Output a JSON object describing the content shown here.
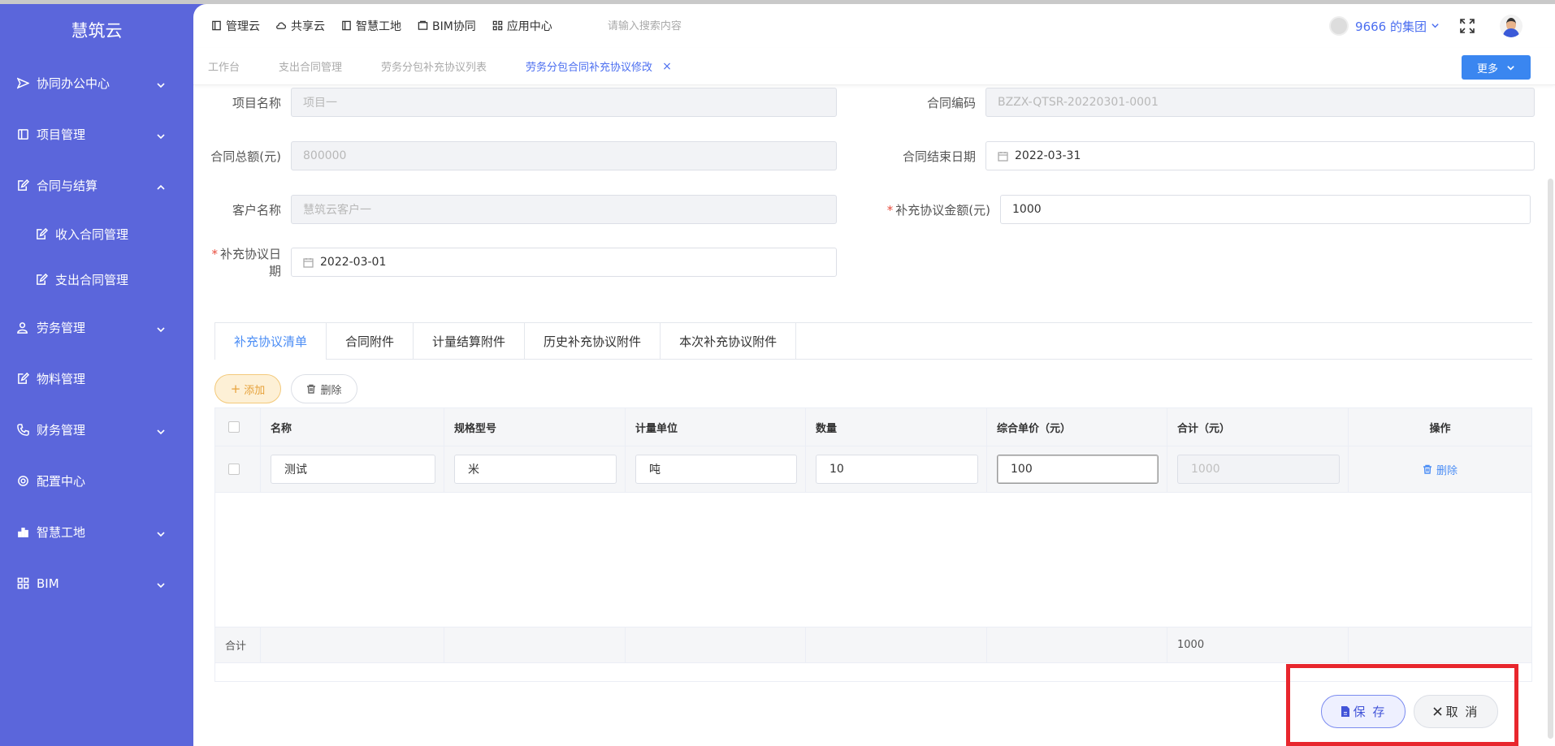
{
  "sidebar": {
    "brand": "慧筑云",
    "items": [
      {
        "label": "协同办公中心"
      },
      {
        "label": "项目管理"
      },
      {
        "label": "合同与结算"
      },
      {
        "label": "收入合同管理"
      },
      {
        "label": "支出合同管理"
      },
      {
        "label": "劳务管理"
      },
      {
        "label": "物料管理"
      },
      {
        "label": "财务管理"
      },
      {
        "label": "配置中心"
      },
      {
        "label": "智慧工地"
      },
      {
        "label": "BIM"
      }
    ]
  },
  "header": {
    "nav": [
      "管理云",
      "共享云",
      "智慧工地",
      "BIM协同",
      "应用中心"
    ],
    "search_placeholder": "请输入搜索内容",
    "org_name": "9666 的集团"
  },
  "tabs": {
    "items": [
      "工作台",
      "支出合同管理",
      "劳务分包补充协议列表",
      "劳务分包合同补充协议修改"
    ],
    "close": "×",
    "more": "更多"
  },
  "form": {
    "project_name_label": "项目名称",
    "project_name_value": "项目一",
    "contract_code_label": "合同编码",
    "contract_code_value": "BZZX-QTSR-20220301-0001",
    "total_amount_label": "合同总额(元)",
    "total_amount_value": "800000",
    "end_date_label": "合同结束日期",
    "end_date_value": "2022-03-31",
    "customer_label": "客户名称",
    "customer_value": "慧筑云客户一",
    "supp_amount_label": "补充协议金额(元)",
    "supp_amount_value": "1000",
    "supp_date_label": "补充协议日期",
    "supp_date_value": "2022-03-01",
    "required_mark": "*"
  },
  "subtabs": [
    "补充协议清单",
    "合同附件",
    "计量结算附件",
    "历史补充协议附件",
    "本次补充协议附件"
  ],
  "actions": {
    "add": "添加",
    "add_icon": "+",
    "delete": "删除"
  },
  "table": {
    "headers": [
      "名称",
      "规格型号",
      "计量单位",
      "数量",
      "综合单价（元）",
      "合计（元）",
      "操作"
    ],
    "row": {
      "name": "测试",
      "spec": "米",
      "unit": "吨",
      "qty": "10",
      "price": "100",
      "total": "1000",
      "op": "删除"
    },
    "footer_label": "合计",
    "footer_total": "1000"
  },
  "buttons": {
    "save": "保 存",
    "cancel": "取 消"
  },
  "colors": {
    "sidebar": "#5b66db",
    "accent": "#4b6ef0",
    "highlight_box": "#e8262d"
  }
}
